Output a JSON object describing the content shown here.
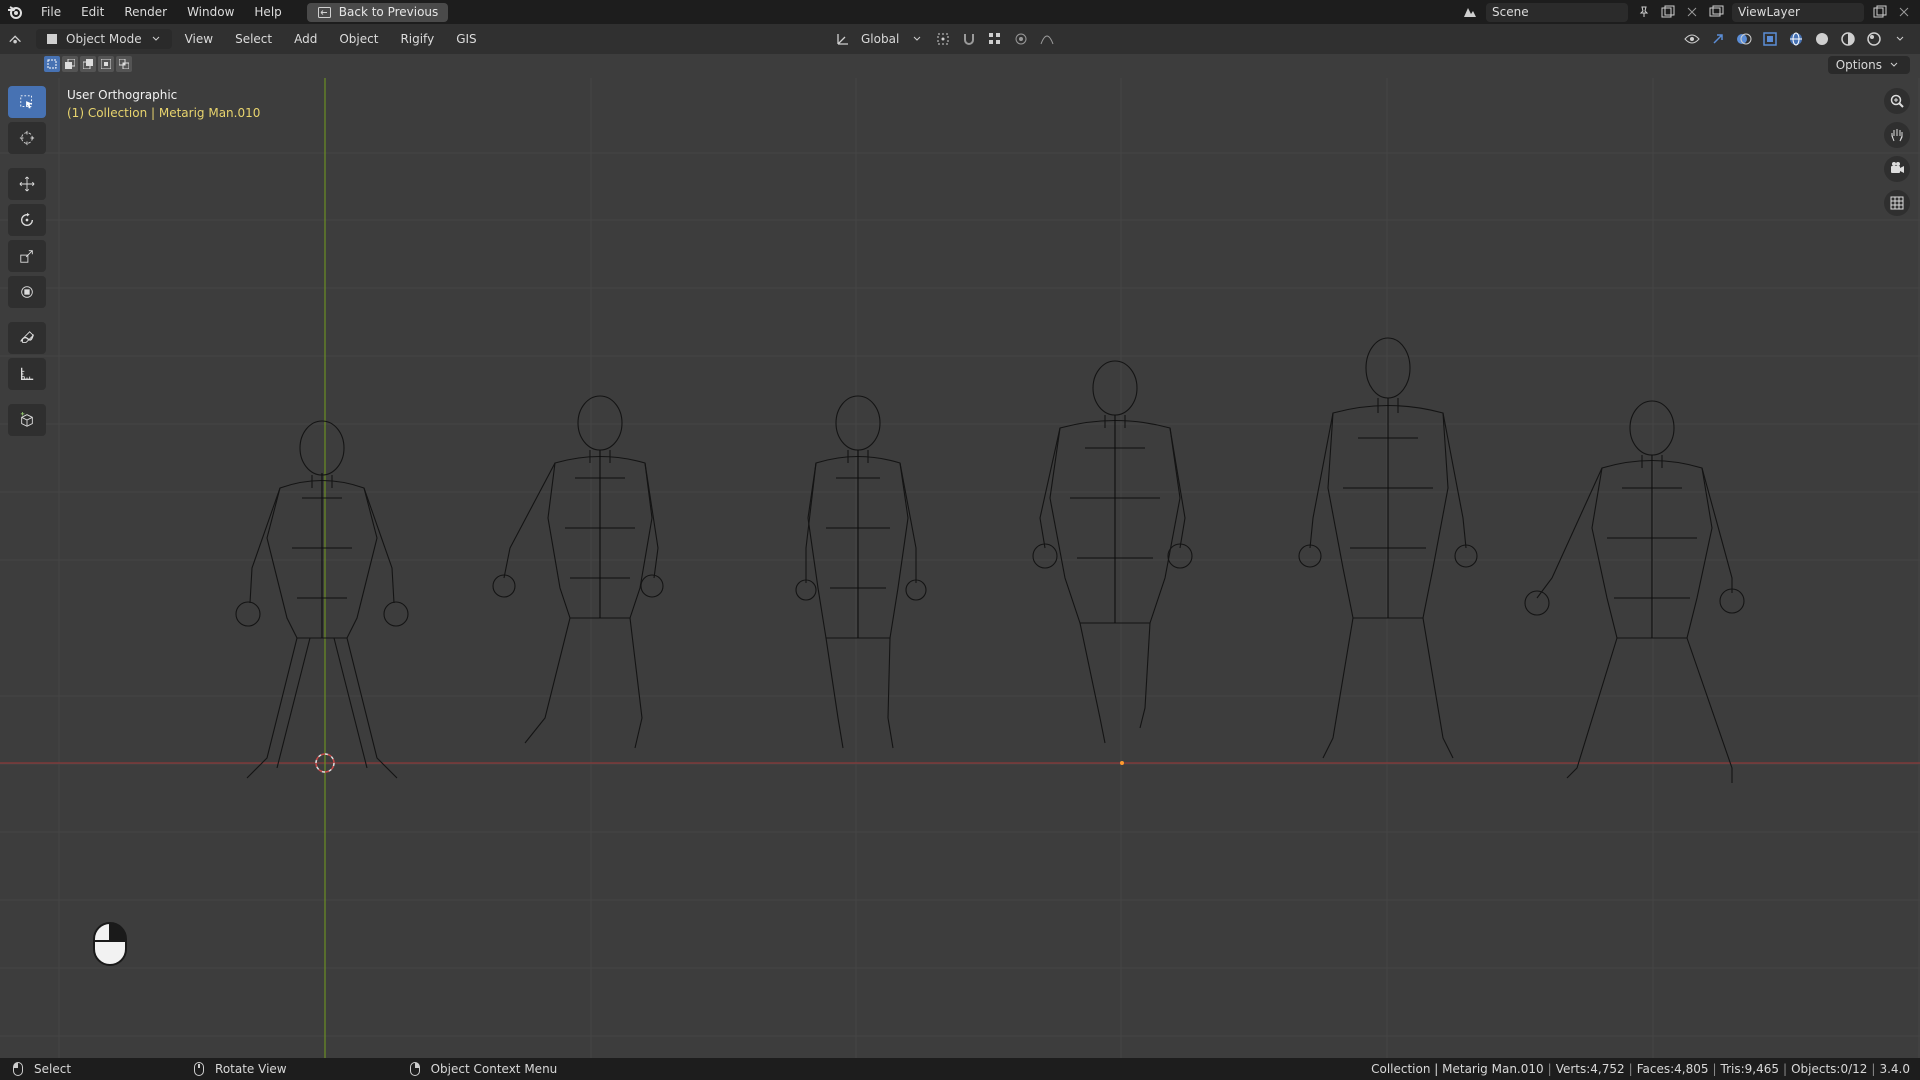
{
  "colors": {
    "accent": "#4772b3",
    "x_axis": "#8b3a3a",
    "y_axis": "#6b8e23",
    "highlight": "#e8d46e"
  },
  "topbar": {
    "menus": [
      "File",
      "Edit",
      "Render",
      "Window",
      "Help"
    ],
    "back_label": "Back to Previous",
    "scene": "Scene",
    "viewlayer": "ViewLayer"
  },
  "header": {
    "mode": "Object Mode",
    "menus": [
      "View",
      "Select",
      "Add",
      "Object",
      "Rigify",
      "GIS"
    ],
    "orientation": "Global"
  },
  "options_label": "Options",
  "viewport": {
    "title": "User Orthographic",
    "subtitle": "(1) Collection | Metarig Man.010"
  },
  "toolbar": {
    "tools": [
      "select-box-icon",
      "cursor-icon",
      "move-icon",
      "rotate-icon",
      "scale-icon",
      "transform-icon",
      "annotate-icon",
      "measure-icon",
      "add-cube-icon"
    ]
  },
  "statusbar": {
    "left": [
      {
        "icon": "mouse-left-icon",
        "label": "Select"
      },
      {
        "icon": "mouse-middle-icon",
        "label": "Rotate View"
      },
      {
        "icon": "mouse-right-icon",
        "label": "Object Context Menu"
      }
    ],
    "stats": [
      "Collection | Metarig Man.010",
      "Verts:4,752",
      "Faces:4,805",
      "Tris:9,465",
      "Objects:0/12",
      "3.4.0"
    ]
  }
}
